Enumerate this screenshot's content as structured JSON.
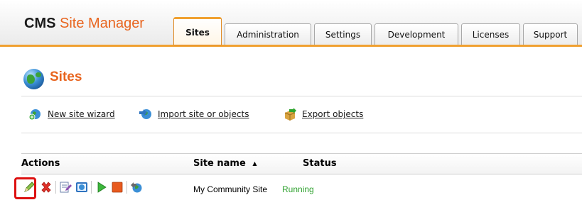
{
  "header": {
    "brand_cms": "CMS",
    "brand_name": "Site Manager",
    "tabs": [
      {
        "label": "Sites",
        "active": true
      },
      {
        "label": "Administration",
        "active": false
      },
      {
        "label": "Settings",
        "active": false
      },
      {
        "label": "Development",
        "active": false
      },
      {
        "label": "Licenses",
        "active": false
      },
      {
        "label": "Support",
        "active": false
      }
    ]
  },
  "page": {
    "title": "Sites",
    "icon": "globe-icon"
  },
  "actions": [
    {
      "label": "New site wizard",
      "icon": "globe-add-icon"
    },
    {
      "label": "Import site or objects",
      "icon": "import-icon"
    },
    {
      "label": "Export objects",
      "icon": "export-icon"
    }
  ],
  "grid": {
    "columns": {
      "actions": "Actions",
      "site_name": "Site name",
      "sort_indicator": "▲",
      "status": "Status"
    },
    "rows": [
      {
        "site_name": "My Community Site",
        "status": "Running",
        "row_actions": [
          "edit-icon",
          "delete-icon",
          "edit-site-icon",
          "preview-icon",
          "start-icon",
          "stop-icon",
          "export-site-icon"
        ]
      }
    ]
  },
  "colors": {
    "accent": "#e8641e",
    "tab_border": "#f0a030",
    "status_running": "#2ea12e",
    "highlight": "#dd1111"
  }
}
